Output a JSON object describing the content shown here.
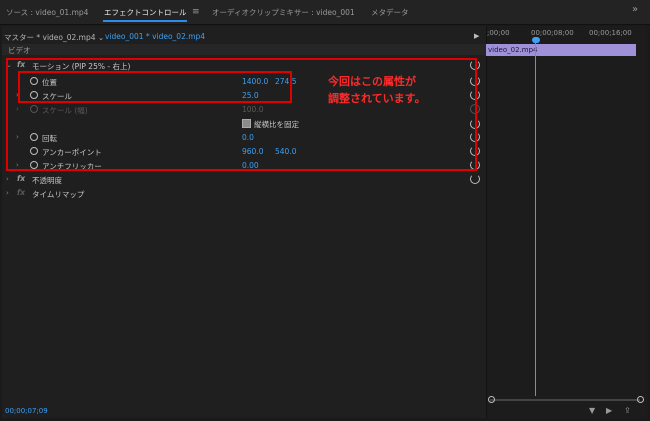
{
  "tabs": [
    {
      "label": "ソース : video_01.mp4"
    },
    {
      "label": "エフェクトコントロール"
    },
    {
      "label": "オーディオクリップミキサー : video_001"
    },
    {
      "label": "メタデータ"
    }
  ],
  "source_bar": {
    "master": "マスター * video_02.mp4",
    "sequence": "video_001 * video_02.mp4"
  },
  "section_label": "ビデオ",
  "motion": {
    "fx": "fx",
    "label": "モーション (PIP 25% - 右上)"
  },
  "properties": {
    "position": {
      "label": "位置",
      "x": "1400.0",
      "y": "274.5"
    },
    "scale": {
      "label": "スケール",
      "value": "25.0"
    },
    "scale_width": {
      "label": "スケール (幅)",
      "value": "100.0"
    },
    "uniform": {
      "label": "縦横比を固定"
    },
    "rotation": {
      "label": "回転",
      "value": "0.0"
    },
    "anchor": {
      "label": "アンカーポイント",
      "x": "960.0",
      "y": "540.0"
    },
    "flicker": {
      "label": "アンチフリッカー",
      "value": "0.00"
    }
  },
  "opacity": {
    "fx": "fx",
    "label": "不透明度"
  },
  "timeremap": {
    "fx": "fx",
    "label": "タイムリマップ"
  },
  "annotation": {
    "line1": "今回はこの属性が",
    "line2": "調整されています。"
  },
  "timecode": "00;00;07;09",
  "timeline": {
    "ruler": [
      ";00;00",
      "00;00;08;00",
      "00;00;16;00"
    ],
    "clip": "video_02.mp4"
  },
  "colors": {
    "accent": "#3da0f5",
    "highlight": "#e00000",
    "clip": "#9f90d8"
  }
}
